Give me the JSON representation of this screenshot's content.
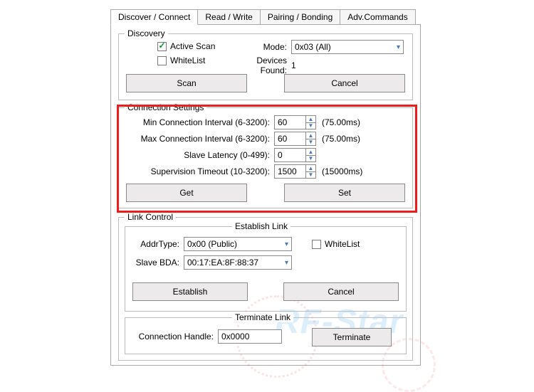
{
  "tabs": {
    "discover": "Discover / Connect",
    "readwrite": "Read / Write",
    "pairing": "Pairing / Bonding",
    "advcmd": "Adv.Commands"
  },
  "discovery": {
    "legend": "Discovery",
    "active_scan_label": "Active Scan",
    "active_scan_checked": true,
    "whitelist_label": "WhiteList",
    "whitelist_checked": false,
    "mode_label": "Mode:",
    "mode_value": "0x03 (All)",
    "devices_found_label": "Devices Found:",
    "devices_found_value": "1",
    "scan_label": "Scan",
    "cancel_label": "Cancel"
  },
  "conn": {
    "legend": "Connection Settings",
    "min_label": "Min Connection Interval (6-3200):",
    "min_value": "60",
    "min_hint": "(75.00ms)",
    "max_label": "Max Connection Interval (6-3200):",
    "max_value": "60",
    "max_hint": "(75.00ms)",
    "slat_label": "Slave Latency (0-499):",
    "slat_value": "0",
    "sup_label": "Supervision Timeout (10-3200):",
    "sup_value": "1500",
    "sup_hint": "(15000ms)",
    "get_label": "Get",
    "set_label": "Set"
  },
  "link": {
    "legend": "Link Control",
    "est_legend": "Establish Link",
    "addrtype_label": "AddrType:",
    "addrtype_value": "0x00 (Public)",
    "whitelist_label": "WhiteList",
    "slavebda_label": "Slave BDA:",
    "slavebda_value": "00:17:EA:8F:88:37",
    "establish_label": "Establish",
    "cancel_label": "Cancel",
    "term_legend": "Terminate Link",
    "connhandle_label": "Connection Handle:",
    "connhandle_value": "0x0000",
    "terminate_label": "Terminate"
  },
  "watermark": "RF-Star"
}
